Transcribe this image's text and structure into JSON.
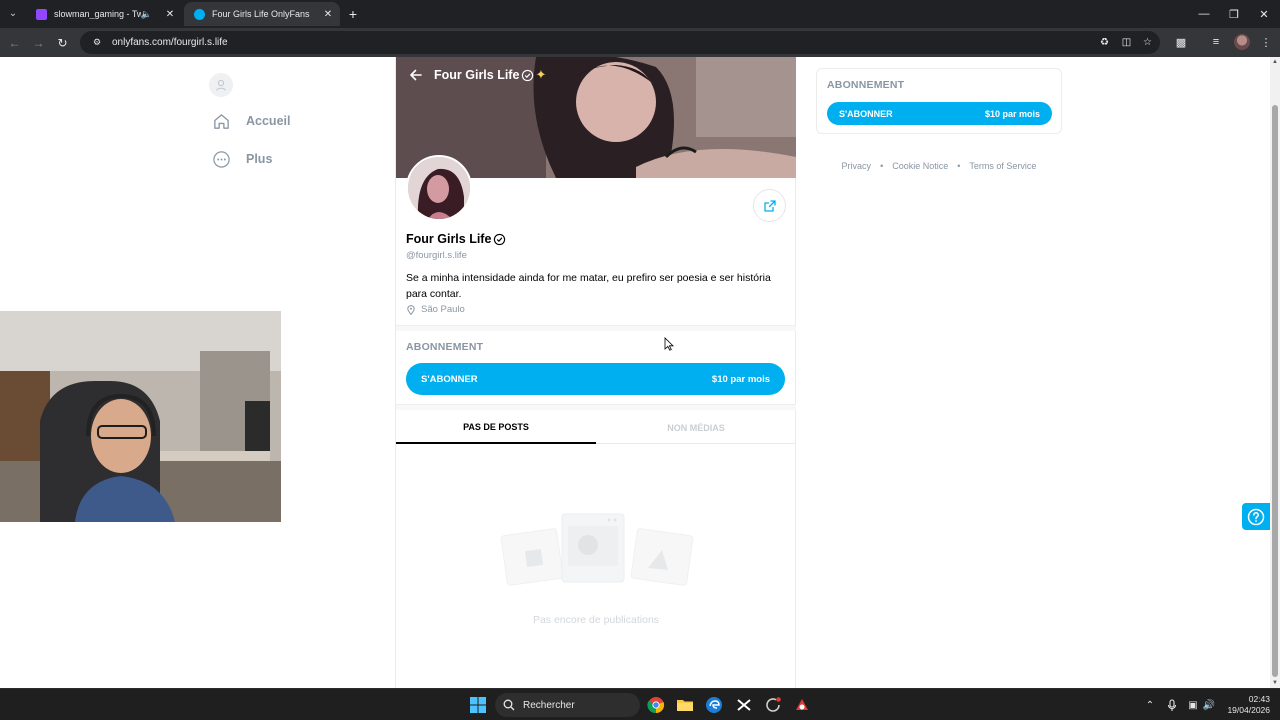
{
  "browser": {
    "tabs": [
      {
        "title": "slowman_gaming - Twitch",
        "active": false,
        "favicon_color": "#9146ff"
      },
      {
        "title": "Four Girls Life OnlyFans",
        "active": true,
        "favicon_color": "#00aff0"
      }
    ],
    "url": "onlyfans.com/fourgirl.s.life"
  },
  "sidebar_nav": {
    "items": [
      {
        "label": "Accueil",
        "icon": "home-icon"
      },
      {
        "label": "Plus",
        "icon": "more-dots-icon"
      }
    ]
  },
  "profile": {
    "header_name": "Four Girls Life",
    "name": "Four Girls Life",
    "handle": "@fourgirl.s.life",
    "bio": "Se a minha intensidade ainda for me matar, eu prefiro ser poesia e ser história para contar.",
    "location": "São Paulo",
    "subscription": {
      "title": "ABONNEMENT",
      "button_label": "S'ABONNER",
      "price": "$10 par mois"
    },
    "tabs": [
      {
        "label": "PAS DE POSTS",
        "active": true
      },
      {
        "label": "NON MÉDIAS",
        "active": false
      }
    ],
    "empty_message": "Pas encore de publications"
  },
  "side_panel": {
    "title": "ABONNEMENT",
    "button_label": "S'ABONNER",
    "price": "$10 par mois",
    "footer_links": [
      "Privacy",
      "Cookie Notice",
      "Terms of Service"
    ]
  },
  "colors": {
    "accent": "#00aff0",
    "muted_text": "#8a96a3"
  },
  "taskbar": {
    "search_placeholder": "Rechercher",
    "time": "02:43",
    "date": "19/04/2026"
  }
}
